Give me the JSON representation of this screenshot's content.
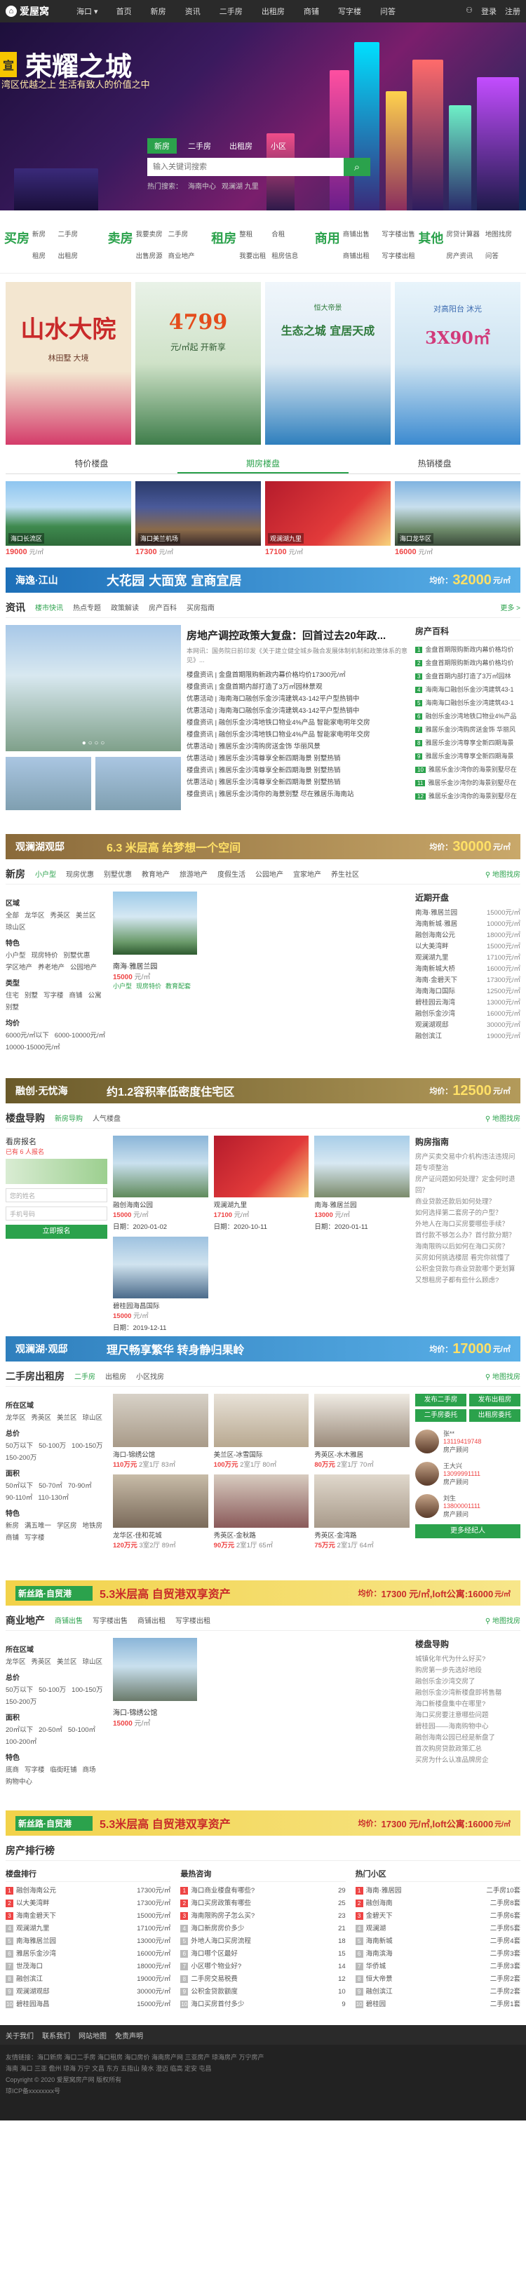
{
  "topbar": {
    "logo": "爱屋窝",
    "city": "海口",
    "nav": [
      "首页",
      "新房",
      "资讯",
      "二手房",
      "出租房",
      "商铺",
      "写字楼",
      "问答"
    ],
    "login": "登录",
    "register": "注册"
  },
  "hero": {
    "tag": "宣",
    "title": "荣耀之城",
    "subtitle": "湾区优越之上 生活有致人的价值之中",
    "search_tabs": [
      "新房",
      "二手房",
      "出租房",
      "小区"
    ],
    "search_placeholder": "输入关键词搜索",
    "hot": [
      "热门搜索：",
      "海南中心",
      "观澜湖 九里"
    ]
  },
  "categories": [
    {
      "name": "买房",
      "links": [
        "新房",
        "二手房",
        "租房",
        "出租房"
      ]
    },
    {
      "name": "卖房",
      "links": [
        "我要卖房",
        "二手房",
        "出售房源",
        "商业地产"
      ]
    },
    {
      "name": "租房",
      "links": [
        "整租",
        "合租",
        "我要出租",
        "租房信息"
      ]
    },
    {
      "name": "商用",
      "links": [
        "商铺出售",
        "写字楼出售",
        "商铺出租",
        "写字楼出租"
      ]
    },
    {
      "name": "其他",
      "links": [
        "房贷计算器",
        "地图找房",
        "房产资讯",
        "问答"
      ]
    }
  ],
  "ads": [
    {
      "title": "山水大院",
      "sub": "林田墅 大境",
      "bg1": "#f3e6d0",
      "bg2": "#d43c6a",
      "tc": "#c92a2a"
    },
    {
      "title": "4799",
      "sub": "元/㎡起 开新享",
      "bg1": "#e9f2e8",
      "bg2": "#3e7d4a",
      "tc": "#e44c1c"
    },
    {
      "title": "生态之城 宜居天成",
      "sub": "恒大帝景",
      "bg1": "#f0f6fb",
      "bg2": "#2f7fbd",
      "tc": "#2e7a3b"
    },
    {
      "title": "3X90㎡",
      "sub": "对高阳台 沐光",
      "bg1": "#e8f4fb",
      "bg2": "#3b8ad0",
      "tc": "#d13a7a"
    }
  ],
  "tabs1": [
    "特价楼盘",
    "期房楼盘",
    "热销楼盘"
  ],
  "tabs1_active": 1,
  "cards1": [
    {
      "name": "海口长流区",
      "price": "19000",
      "unit": "元/㎡"
    },
    {
      "name": "海口美兰机场",
      "price": "17300",
      "unit": "元/㎡"
    },
    {
      "name": "观澜湖九里",
      "price": "17100",
      "unit": "元/㎡"
    },
    {
      "name": "海口龙华区",
      "price": "16000",
      "unit": "元/㎡"
    }
  ],
  "banner1": {
    "brand": "海逸·江山",
    "text": "大花园  大面宽  宜商宜居",
    "price_label": "均价：",
    "price": "32000",
    "unit": "元/㎡"
  },
  "news": {
    "section": "资讯",
    "tabs": [
      "楼市快讯",
      "热点专题",
      "政策解读",
      "房产百科",
      "买房指南"
    ],
    "more": "更多 >",
    "headline": "房地产调控政策大复盘：回首过去20年政...",
    "summary": "本网讯：国务院日前印发《关于建立健全城乡融合发展体制机制和政策体系的意见》...",
    "items": [
      "楼盘资讯 | 金盘首期限购新政内幕价格均价17300元/㎡",
      "楼盘资讯 | 金盘首期内部打造了3万㎡园林景观",
      "优惠活动 | 海南海口融创乐金沙湾建筑43-142平户型热销中",
      "优惠活动 | 海南海口融创乐金沙湾建筑43-142平户型热销中",
      "楼盘资讯 | 融创乐金沙湾地铁口物业4%产品 智能家电明年交房",
      "楼盘资讯 | 融创乐金沙湾地铁口物业4%产品 智能家电明年交房",
      "优惠活动 | 雅居乐金沙湾购房送金饰 华丽风景",
      "优惠活动 | 雅居乐金沙湾尊享全新四期海景 别墅热销",
      "楼盘资讯 | 雅居乐金沙湾尊享全新四期海景 别墅热销",
      "优惠活动 | 雅居乐金沙湾尊享全新四期海景 别墅热销",
      "楼盘资讯 | 雅居乐金沙湾你的海景别墅 尽在雅居乐海南站"
    ],
    "right_title": "房产百科",
    "right_items": [
      "金盘首期限购新政内幕价格均价",
      "金盘首期限购新政内幕价格均价",
      "金盘首期内部打造了3万㎡园林",
      "海南海口融创乐金沙湾建筑43-1",
      "海南海口融创乐金沙湾建筑43-1",
      "融创乐金沙湾地铁口物业4%产品",
      "雅居乐金沙湾购房送金饰 华丽风",
      "雅居乐金沙湾尊享全新四期海景",
      "雅居乐金沙湾尊享全新四期海景",
      "雅居乐金沙湾你的海景别墅尽在",
      "雅居乐金沙湾你的海景别墅尽在",
      "雅居乐金沙湾你的海景别墅尽在"
    ],
    "banner": {
      "brand": "观澜湖观邸",
      "text": "6.3 米层高 给梦想一个空间",
      "price_label": "均价：",
      "price": "30000",
      "unit": "元/㎡"
    }
  },
  "newhouse": {
    "section": "新房",
    "tabs": [
      "小户型",
      "现房优惠",
      "别墅优惠",
      "教育地产",
      "旅游地产",
      "度假生活",
      "公园地产",
      "宜家地产",
      "养生社区"
    ],
    "more": "地图找房",
    "filters": [
      {
        "label": "区域",
        "opts": [
          "全部",
          "龙华区",
          "秀英区",
          "美兰区",
          "琼山区"
        ]
      },
      {
        "label": "特色",
        "opts": [
          "小户型",
          "现房特价",
          "别墅优惠",
          "学区地产",
          "养老地产",
          "公园地产"
        ]
      },
      {
        "label": "类型",
        "opts": [
          "住宅",
          "别墅",
          "写字楼",
          "商铺",
          "公寓",
          "别墅"
        ]
      },
      {
        "label": "均价",
        "opts": [
          "6000元/㎡以下",
          "6000-10000元/㎡",
          "10000-15000元/㎡"
        ]
      }
    ],
    "item": {
      "name": "南海·雅居兰园",
      "price": "15000",
      "unit": "元/㎡",
      "tags": [
        "小户型",
        "现房特价",
        "教育配套"
      ]
    },
    "side_title": "近期开盘",
    "side": [
      [
        "南海·雅居兰园",
        "15000元/㎡"
      ],
      [
        "海南新城·雅居",
        "10000元/㎡"
      ],
      [
        "融创海南公元",
        "18000元/㎡"
      ],
      [
        "以大美湾畔",
        "15000元/㎡"
      ],
      [
        "观澜湖九里",
        "17100元/㎡"
      ],
      [
        "海南新城大桥",
        "16000元/㎡"
      ],
      [
        "海南·金碧天下",
        "17300元/㎡"
      ],
      [
        "海南海口国际",
        "12500元/㎡"
      ],
      [
        "碧桂园云海湾",
        "13000元/㎡"
      ],
      [
        "融创乐金沙湾",
        "16000元/㎡"
      ],
      [
        "观澜湖观邸",
        "30000元/㎡"
      ],
      [
        "融创滨江",
        "19000元/㎡"
      ]
    ],
    "banner": {
      "brand": "融创·无忧海",
      "text": "约1.2容积率低密度住宅区",
      "price_label": "均价：",
      "price": "12500",
      "unit": "元/㎡"
    }
  },
  "guide": {
    "section": "楼盘导购",
    "tabs": [
      "新房导购",
      "人气楼盘"
    ],
    "more": "地图找房",
    "left_title": "看房报名",
    "left_sub": "已有 6 人报名",
    "name_ph": "您的姓名",
    "phone_ph": "手机号码",
    "btn": "立即报名",
    "items": [
      {
        "name": "融创海南公园",
        "price": "15000",
        "date": "日期：2020-01-02"
      },
      {
        "name": "观澜湖九里",
        "price": "17100",
        "date": "日期：2020-10-11"
      },
      {
        "name": "南海·雅居兰园",
        "price": "13000",
        "date": "日期：2020-01-11"
      },
      {
        "name": "碧桂园海昌国际",
        "price": "15000",
        "date": "日期：2019-12-11"
      }
    ],
    "right_title": "购房指南",
    "right_items": [
      "房产买卖交易中介机构违法违规问题专项整治",
      "房产证问题如何处理？定金何时退回？",
      "商业贷款还款后如何处理？",
      "如何选择第二套房子的户型？",
      "外地人在海口买房要哪些手续？",
      "首付款不够怎么办？首付款分期？",
      "海南限购以后如何在海口买房？",
      "买房如何挑选楼层 看完你就懂了",
      "公积金贷款与商业贷款哪个更划算",
      "又想租房子都有些什么顾虑?"
    ],
    "banner": {
      "brand": "观澜湖·观邸",
      "text": "理尺畅享繁华  转身静归果岭",
      "price_label": "均价：",
      "price": "17000",
      "unit": "元/㎡"
    }
  },
  "rent": {
    "section": "二手房出租房",
    "tabs": [
      "二手房",
      "出租房",
      "小区找房"
    ],
    "more": "地图找房",
    "filters": [
      {
        "label": "所在区域",
        "opts": [
          "龙华区",
          "秀英区",
          "美兰区",
          "琼山区"
        ]
      },
      {
        "label": "总价",
        "opts": [
          "50万以下",
          "50-100万",
          "100-150万",
          "150-200万"
        ]
      },
      {
        "label": "面积",
        "opts": [
          "50㎡以下",
          "50-70㎡",
          "70-90㎡",
          "90-110㎡",
          "110-130㎡"
        ]
      },
      {
        "label": "特色",
        "opts": [
          "新房",
          "满五唯一",
          "学区房",
          "地铁房",
          "商铺",
          "写字楼"
        ]
      }
    ],
    "items": [
      {
        "l1": "海口-锦绣公馆",
        "l2": "110万元",
        "l2b": "2室1厅 83㎡"
      },
      {
        "l1": "美兰区-冰雪国际",
        "l2": "100万元",
        "l2b": "2室1厅 80㎡"
      },
      {
        "l1": "秀英区-水木雅居",
        "l2": "80万元",
        "l2b": "2室1厅 70㎡"
      },
      {
        "l1": "龙华区-佳和花城",
        "l2": "120万元",
        "l2b": "3室2厅 89㎡"
      },
      {
        "l1": "秀英区-金秋路",
        "l2": "90万元",
        "l2b": "2室1厅 65㎡"
      },
      {
        "l1": "秀英区-金湾路",
        "l2": "75万元",
        "l2b": "2室1厅 64㎡"
      }
    ],
    "btns": [
      "发布二手房",
      "发布出租房",
      "二手房委托",
      "出租房委托"
    ],
    "agents": [
      {
        "name": "张**",
        "phone": "13119419748",
        "tag": "房产顾问"
      },
      {
        "name": "王大兴",
        "phone": "13099991111",
        "tag": "房产顾问"
      },
      {
        "name": "刘生",
        "phone": "13800001111",
        "tag": "房产顾问"
      }
    ],
    "agent_btn": "更多经纪人",
    "banner": {
      "brand": "新丝路·自贸港",
      "text": "5.3米层高 自贸港双享资产",
      "price_label": "均价：",
      "price": "17300 元/㎡,loft公寓:16000",
      "unit": "元/㎡"
    }
  },
  "commercial": {
    "section": "商业地产",
    "tabs": [
      "商铺出售",
      "写字楼出售",
      "商铺出租",
      "写字楼出租"
    ],
    "more": "地图找房",
    "filters": [
      {
        "label": "所在区域",
        "opts": [
          "龙华区",
          "秀英区",
          "美兰区",
          "琼山区"
        ]
      },
      {
        "label": "总价",
        "opts": [
          "50万以下",
          "50-100万",
          "100-150万",
          "150-200万"
        ]
      },
      {
        "label": "面积",
        "opts": [
          "20㎡以下",
          "20-50㎡",
          "50-100㎡",
          "100-200㎡"
        ]
      },
      {
        "label": "特色",
        "opts": [
          "底商",
          "写字楼",
          "临街旺铺",
          "商场",
          "购物中心"
        ]
      }
    ],
    "item": {
      "name": "海口-锦绣公馆",
      "price": "15000",
      "unit": "元/㎡"
    },
    "right_title": "楼盘导购",
    "right_items": [
      "城镇化年代为什么好买?",
      "购房第一步先选好地段",
      "融创乐金沙湾交房了",
      "融创乐金沙湾新楼盘即将售罄",
      "海口新楼盘集中在哪里?",
      "海口买房要注意哪些问题",
      "碧桂园——海南购物中心",
      "融创海南公园已经是新盘了",
      "首次购房贷款政策汇总",
      "买房为什么认准品牌房企"
    ],
    "banner": {
      "brand": "新丝路·自贸港",
      "text": "5.3米层高 自贸港双享资产",
      "price_label": "均价：",
      "price": "17300 元/㎡,loft公寓:16000",
      "unit": "元/㎡"
    }
  },
  "ranking": {
    "section": "房产排行榜",
    "cols": [
      {
        "title": "楼盘排行",
        "rows": [
          [
            "融创海南公元",
            "17300元/㎡"
          ],
          [
            "以大美湾畔",
            "17300元/㎡"
          ],
          [
            "海南金碧天下",
            "15000元/㎡"
          ],
          [
            "观澜湖九里",
            "17100元/㎡"
          ],
          [
            "南海雅居兰园",
            "13000元/㎡"
          ],
          [
            "雅居乐金沙湾",
            "16000元/㎡"
          ],
          [
            "世茂海口",
            "18000元/㎡"
          ],
          [
            "融创滨江",
            "19000元/㎡"
          ],
          [
            "观澜湖观邸",
            "30000元/㎡"
          ],
          [
            "碧桂园海昌",
            "15000元/㎡"
          ]
        ]
      },
      {
        "title": "最热咨询",
        "rows": [
          [
            "海口商业楼盘有哪些?",
            "29"
          ],
          [
            "海口买房政策有哪些",
            "25"
          ],
          [
            "海南限购房子怎么买?",
            "23"
          ],
          [
            "海口新房房价多少",
            "21"
          ],
          [
            "外地人海口买房流程",
            "18"
          ],
          [
            "海口哪个区最好",
            "15"
          ],
          [
            "小区哪个物业好?",
            "14"
          ],
          [
            "二手房交易税费",
            "12"
          ],
          [
            "公积金贷款额度",
            "10"
          ],
          [
            "海口买房首付多少",
            "9"
          ]
        ]
      },
      {
        "title": "热门小区",
        "rows": [
          [
            "海南·雅居园",
            "二手房10套"
          ],
          [
            "融创海南",
            "二手房8套"
          ],
          [
            "金碧天下",
            "二手房6套"
          ],
          [
            "观澜湖",
            "二手房5套"
          ],
          [
            "海南新城",
            "二手房4套"
          ],
          [
            "海南滨海",
            "二手房3套"
          ],
          [
            "华侨城",
            "二手房3套"
          ],
          [
            "恒大帝景",
            "二手房2套"
          ],
          [
            "融创滨江",
            "二手房2套"
          ],
          [
            "碧桂园",
            "二手房1套"
          ]
        ]
      }
    ]
  },
  "footer": {
    "links": [
      "关于我们",
      "联系我们",
      "网站地图",
      "免责声明"
    ],
    "lines": [
      "友情链接：海口新房 海口二手房 海口租房 海口房价 海南房产网 三亚房产 琼海房产 万宁房产",
      "海南 海口 三亚 儋州 琼海 万宁 文昌 东方 五指山 陵水 澄迈 临高 定安 屯昌",
      "Copyright © 2020 爱屋窝房产网 版权所有",
      "琼ICP备xxxxxxxx号"
    ]
  }
}
